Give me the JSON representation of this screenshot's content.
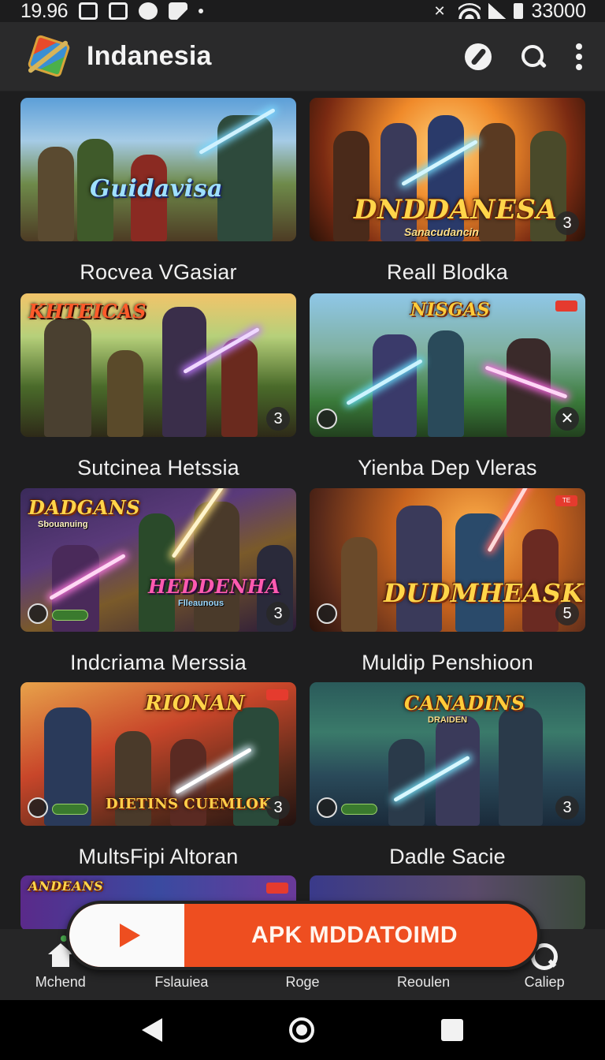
{
  "status_bar": {
    "time": "19.96",
    "right_text": "33000"
  },
  "app_bar": {
    "title": "Indanesia",
    "actions": [
      "compass-icon",
      "search-icon",
      "more-vert-icon"
    ]
  },
  "games": [
    {
      "title": "Rocvea VGasiar",
      "art_text": "Guidavisa",
      "art_subtext": "",
      "badge": "",
      "tag": ""
    },
    {
      "title": "Reall Blodka",
      "art_text": "DNDDANESA",
      "art_subtext": "Sanacudancin",
      "badge": "3",
      "tag": ""
    },
    {
      "title": "Sutcinea Hetssia",
      "art_text": "KHTEICAS",
      "art_subtext": "",
      "badge": "3",
      "tag": ""
    },
    {
      "title": "Yienba Dep Vleras",
      "art_text": "NISGAS",
      "art_subtext": "",
      "badge": "",
      "tag": ""
    },
    {
      "title": "Indcriama Merssia",
      "art_text": "DADGANS",
      "art_subtext": "Sbouanuing",
      "art_text2": "HEDDENHA",
      "art_subtext2": "Flleaunous",
      "badge": "3",
      "tag": ""
    },
    {
      "title": "Muldip Penshioon",
      "art_text": "DUDMHEASK",
      "art_subtext": "",
      "badge": "5",
      "tag": "TE"
    },
    {
      "title": "MultsFipi Altoran",
      "art_text": "RIONAN",
      "art_subtext": "",
      "art_text2": "DIETINS CUEMLOK",
      "badge": "3",
      "tag": ""
    },
    {
      "title": "Dadle Sacie",
      "art_text": "CANADINS",
      "art_subtext": "DRAIDEN",
      "badge": "3",
      "tag": ""
    },
    {
      "title": "",
      "art_text": "ANDEANS",
      "art_subtext": "",
      "badge": "",
      "tag": ""
    },
    {
      "title": "",
      "art_text": "",
      "art_subtext": "",
      "badge": "",
      "tag": ""
    }
  ],
  "banner": {
    "label": "APK MDDATOIMD",
    "icon": "play-icon"
  },
  "bottom_nav": [
    {
      "label": "Mchend",
      "icon": "home-icon"
    },
    {
      "label": "Fslauiea",
      "icon": ""
    },
    {
      "label": "Roge",
      "icon": ""
    },
    {
      "label": "Reoulen",
      "icon": ""
    },
    {
      "label": "Caliep",
      "icon": "help-search-icon"
    }
  ],
  "colors": {
    "accent": "#ee4e20",
    "background": "#1e1e1f",
    "appbar": "#2a2a2b"
  }
}
